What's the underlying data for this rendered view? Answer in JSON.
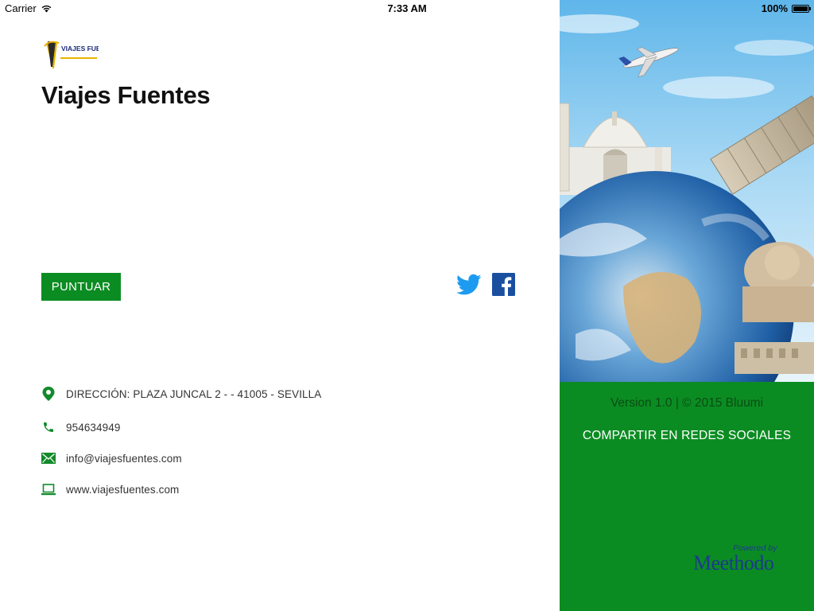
{
  "status_bar": {
    "carrier": "Carrier",
    "time": "7:33 AM",
    "battery": "100%"
  },
  "logo": {
    "text": "VIAJES FUENTES"
  },
  "title": "Viajes Fuentes",
  "rate_button": "PUNTUAR",
  "social_icons": [
    "twitter-icon",
    "facebook-icon"
  ],
  "contact": {
    "address": "DIRECCIÓN: PLAZA JUNCAL 2 - - 41005 - SEVILLA",
    "phone": "954634949",
    "email": "info@viajesfuentes.com",
    "website": "www.viajesfuentes.com"
  },
  "panel": {
    "version": "Version 1.0 | © 2015 Bluumi",
    "share": "COMPARTIR EN REDES SOCIALES",
    "powered_by": "Powered by",
    "brand": "Meethodo"
  },
  "colors": {
    "accent_green": "#0b8c22",
    "twitter_blue": "#1d9bf0",
    "facebook_blue": "#1a4fa0",
    "brand_blue": "#1b3b8c"
  }
}
